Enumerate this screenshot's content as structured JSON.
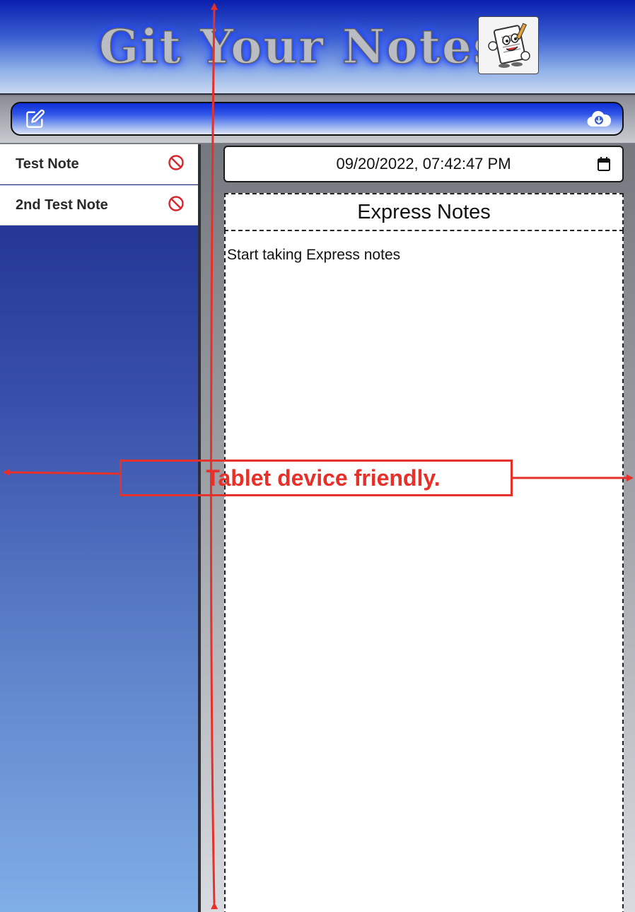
{
  "header": {
    "app_title": "Git Your Notes",
    "logo_icon": "notepad-mascot-icon"
  },
  "toolbar": {
    "new_note_icon": "edit-icon",
    "save_icon": "cloud-download-icon"
  },
  "sidebar": {
    "items": [
      {
        "label": "Test Note",
        "delete_icon": "prohibited-icon"
      },
      {
        "label": "2nd Test Note",
        "delete_icon": "prohibited-icon"
      }
    ]
  },
  "main": {
    "date_value": "09/20/2022, 07:42:47 PM",
    "calendar_icon": "calendar-icon",
    "note_title": "Express Notes",
    "note_body": "Start taking Express notes"
  },
  "annotation": {
    "text": "Tablet device friendly.",
    "color": "#e8302a"
  },
  "colors": {
    "header_blue": "#0a20b0",
    "delete_red": "#d7262e"
  }
}
